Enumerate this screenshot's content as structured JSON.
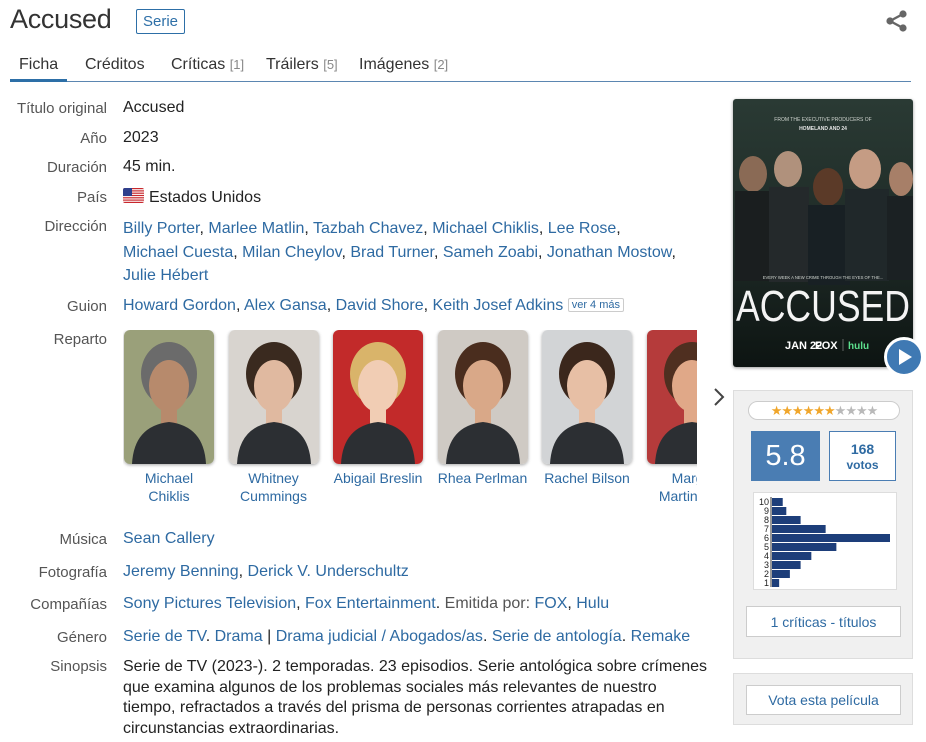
{
  "header": {
    "title": "Accused",
    "badge": "Serie"
  },
  "tabs": [
    {
      "label": "Ficha",
      "count": ""
    },
    {
      "label": "Créditos",
      "count": ""
    },
    {
      "label": "Críticas",
      "count": "[1]"
    },
    {
      "label": "Tráilers",
      "count": "[5]"
    },
    {
      "label": "Imágenes",
      "count": "[2]"
    }
  ],
  "info": {
    "original_title_label": "Título original",
    "original_title": "Accused",
    "year_label": "Año",
    "year": "2023",
    "duration_label": "Duración",
    "duration": "45 min.",
    "country_label": "País",
    "country": "Estados Unidos",
    "direction_label": "Dirección",
    "directors": [
      "Billy Porter",
      "Marlee Matlin",
      "Tazbah Chavez",
      "Michael Chiklis",
      "Lee Rose",
      "Michael Cuesta",
      "Milan Cheylov",
      "Brad Turner",
      "Sameh Zoabi",
      "Jonathan Mostow",
      "Julie Hébert"
    ],
    "script_label": "Guion",
    "writers": [
      "Howard Gordon",
      "Alex Gansa",
      "David Shore",
      "Keith Josef Adkins"
    ],
    "writers_more": "ver 4 más",
    "cast_label": "Reparto",
    "music_label": "Música",
    "music": "Sean Callery",
    "photo_label": "Fotografía",
    "photography": [
      "Jeremy Benning",
      "Derick V. Underschultz"
    ],
    "companies_label": "Compañías",
    "companies": [
      "Sony Pictures Television",
      "Fox Entertainment"
    ],
    "broadcast_by_label": "Emitida por:",
    "broadcasters": [
      "FOX",
      "Hulu"
    ],
    "genre_label": "Género",
    "genres_a": [
      "Serie de TV",
      "Drama"
    ],
    "genres_b": [
      "Drama judicial / Abogados/as",
      "Serie de antología",
      "Remake"
    ],
    "synopsis_label": "Sinopsis",
    "synopsis": "Serie de TV (2023-). 2 temporadas. 23 episodios. Serie antológica sobre crímenes que examina algunos de los problemas sociales más relevantes de nuestro tiempo, refractados a través del prisma de personas corrientes atrapadas en circunstancias extraordinarias."
  },
  "cast": [
    {
      "name": "Michael Chiklis",
      "skin": "#b78a6c",
      "hair": "#6b6b6b",
      "bg": "#9aa07a"
    },
    {
      "name": "Whitney Cummings",
      "skin": "#e0b9a0",
      "hair": "#3a2a1f",
      "bg": "#d8d4cf"
    },
    {
      "name": "Abigail Breslin",
      "skin": "#f1cdb4",
      "hair": "#d9b46a",
      "bg": "#c22a2a"
    },
    {
      "name": "Rhea Perlman",
      "skin": "#d9a888",
      "hair": "#4a2d1e",
      "bg": "#cfcac4"
    },
    {
      "name": "Rachel Bilson",
      "skin": "#e7bfa5",
      "hair": "#3b271c",
      "bg": "#d2d4d6"
    },
    {
      "name": "Margo Martindale",
      "skin": "#e0a888",
      "hair": "#4f2f20",
      "bg": "#b53b3b"
    }
  ],
  "poster": {
    "top_line1": "FROM THE EXECUTIVE PRODUCERS OF",
    "top_line2": "HOMELAND AND 24",
    "tagline": "EVERY WEEK A NEW CRIME THROUGH THE EYES OF THE...",
    "title": "ACCUSED",
    "date": "JAN 22",
    "network": "FOX",
    "hulu": "hulu"
  },
  "rating": {
    "score": "5.8",
    "stars_filled": 6,
    "stars_total": 10,
    "votes_count": "168",
    "votes_label": "votos",
    "histogram_labels": [
      "10",
      "9",
      "8",
      "7",
      "6",
      "5",
      "4",
      "3",
      "2",
      "1"
    ],
    "histogram_values": [
      3,
      4,
      8,
      15,
      33,
      18,
      11,
      8,
      5,
      2
    ],
    "critics_label": "1 críticas - títulos",
    "vote_button": "Vota esta película"
  },
  "colors": {
    "link": "#2e6aa2",
    "accent": "#4a7db3",
    "histogram": "#1d3e7a"
  }
}
